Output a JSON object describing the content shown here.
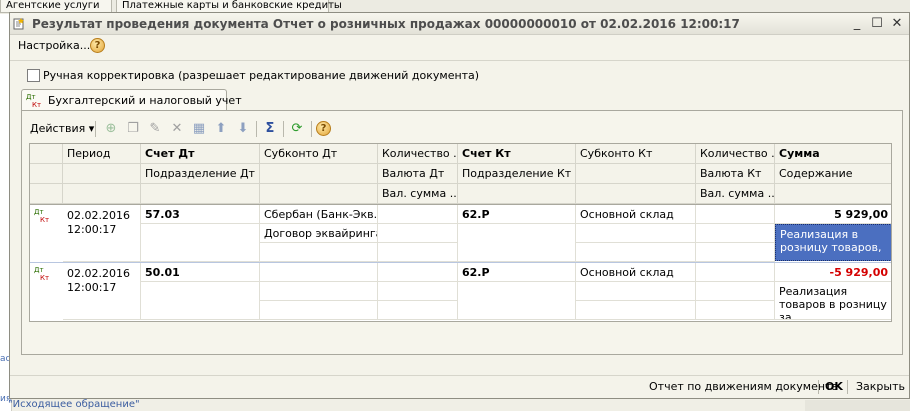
{
  "background": {
    "tabs": [
      "Агентские услуги",
      "Платежные карты и банковские кредиты"
    ],
    "bottom_link": "\"Исходящее обращение\""
  },
  "window": {
    "title": "Результат проведения документа Отчет о розничных продажах 00000000010 от 02.02.2016 12:00:17"
  },
  "settings_label": "Настройка...",
  "manual_edit_label": "Ручная корректировка (разрешает редактирование движений документа)",
  "manual_edit_checked": false,
  "tab_label": "Бухгалтерский и налоговый учет",
  "toolbar": {
    "actions_label": "Действия"
  },
  "columns_top": [
    "Период",
    "Счет Дт",
    "Субконто Дт",
    "Количество ...",
    "Счет Кт",
    "Субконто Кт",
    "Количество ...",
    "Сумма"
  ],
  "columns_mid": [
    "",
    "Подразделение Дт",
    "",
    "Валюта Дт",
    "Подразделение Кт",
    "",
    "Валюта Кт",
    "Содержание"
  ],
  "columns_bot": [
    "",
    "",
    "",
    "Вал. сумма ...",
    "",
    "",
    "Вал. сумма ...",
    ""
  ],
  "rows": [
    {
      "date": "02.02.2016",
      "time": "12:00:17",
      "account_dt": "57.03",
      "subconto_dt_1": "Сбербан (Банк-Экв...",
      "subconto_dt_2": "Договор эквайринга",
      "account_kt": "62.Р",
      "subconto_kt": "Основной склад",
      "sum": "5 929,00",
      "content": "Реализация в розницу товаров, ..."
    },
    {
      "date": "02.02.2016",
      "time": "12:00:17",
      "account_dt": "50.01",
      "subconto_dt_1": "",
      "subconto_dt_2": "",
      "account_kt": "62.Р",
      "subconto_kt": "Основной склад",
      "sum": "-5 929,00",
      "content": "Реализация товаров в розницу за ..."
    }
  ],
  "status_bar": {
    "report_label": "Отчет по движениям документа",
    "ok_label": "OK",
    "close_label": "Закрыть"
  },
  "colors": {
    "selected_cell": "#4b6fc0",
    "negative": "#d40000",
    "title_text": "#4d4d4d"
  },
  "icons": [
    "doc-posting-icon",
    "help-icon",
    "add-icon",
    "copy-icon",
    "edit-icon",
    "delete-icon",
    "post-icon",
    "move-up-icon",
    "move-down-icon",
    "sum-icon",
    "refresh-icon",
    "dt-kt-icon"
  ]
}
